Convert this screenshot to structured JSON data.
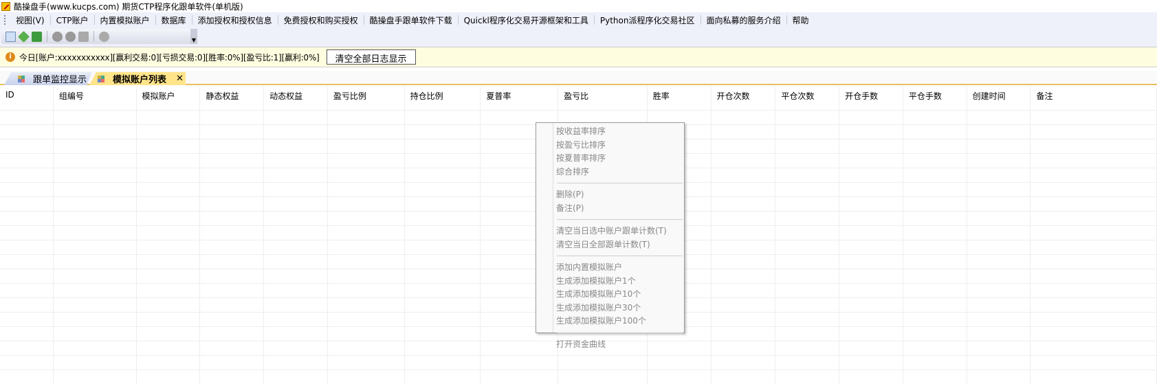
{
  "window": {
    "title": "酷操盘手(www.kucps.com) 期货CTP程序化跟单软件(单机版)"
  },
  "menu": [
    "视图(V)",
    "CTP账户",
    "内置模拟账户",
    "数据库",
    "添加授权和授权信息",
    "免费授权和购买授权",
    "酷操盘手跟单软件下载",
    "Quickl程序化交易开源框架和工具",
    "Python派程序化交易社区",
    "面向私募的服务介绍",
    "帮助"
  ],
  "toolbar": {
    "icons": [
      "new-doc-icon",
      "green-diamond-icon",
      "green-stack-icon",
      "download-icon",
      "upload-icon",
      "home-icon",
      "globe-icon"
    ]
  },
  "info": {
    "text": "今日[账户:xxxxxxxxxxx][赢利交易:0][亏损交易:0][胜率:0%][盈亏比:1][赢利:0%]",
    "clear_button": "清空全部日志显示"
  },
  "tabs": [
    {
      "label": "跟单监控显示",
      "active": false
    },
    {
      "label": "模拟账户列表",
      "active": true
    }
  ],
  "table": {
    "columns": [
      "ID",
      "组编号",
      "模拟账户",
      "静态权益",
      "动态权益",
      "盈亏比例",
      "持仓比例",
      "夏普率",
      "盈亏比",
      "胜率",
      "开仓次数",
      "平仓次数",
      "开仓手数",
      "平仓手数",
      "创建时间",
      "备注"
    ],
    "rows": []
  },
  "context_menu": [
    [
      "按收益率排序",
      "按盈亏比排序",
      "按夏普率排序",
      "综合排序"
    ],
    [
      "删除(P)",
      "备注(P)"
    ],
    [
      "清空当日选中账户跟单计数(T)",
      "清空当日全部跟单计数(T)"
    ],
    [
      "添加内置模拟账户",
      "生成添加模拟账户1个",
      "生成添加模拟账户10个",
      "生成添加模拟账户30个",
      "生成添加模拟账户100个"
    ],
    [
      "打开资金曲线"
    ]
  ]
}
